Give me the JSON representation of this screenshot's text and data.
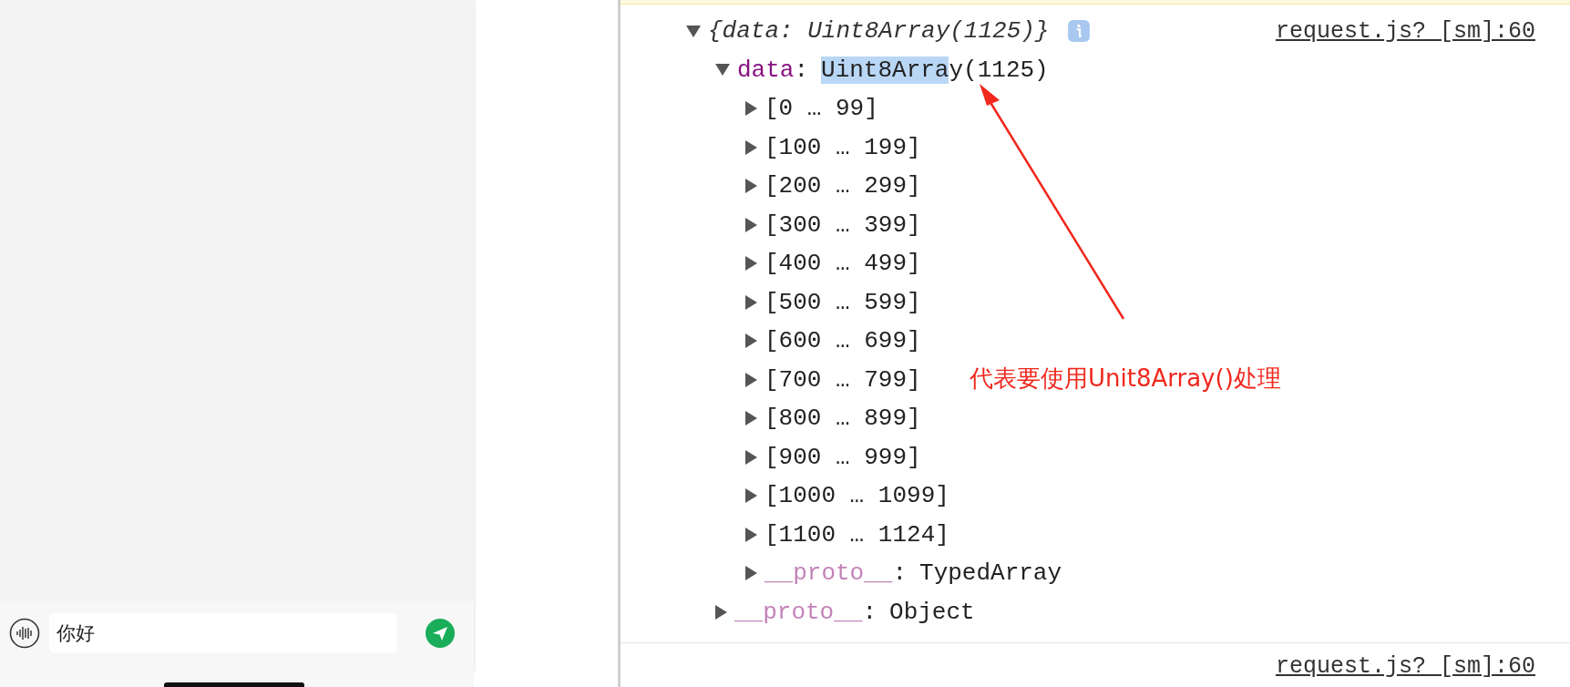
{
  "chat_panel": {
    "input": {
      "value": "你好"
    }
  },
  "console": {
    "entry": {
      "summary": "{data: Uint8Array(1125)}",
      "source": "request.js? [sm]:60",
      "expanded": true,
      "children": [
        {
          "kind": "property",
          "key": "data",
          "separator": ":",
          "dimmed": false,
          "value_parts": [
            {
              "text": "Uint8Arra",
              "selected": true
            },
            {
              "text": "y(1125)",
              "selected": false
            }
          ],
          "expanded": true,
          "children": [
            {
              "kind": "range",
              "label": "[0 … 99]",
              "expanded": false
            },
            {
              "kind": "range",
              "label": "[100 … 199]",
              "expanded": false
            },
            {
              "kind": "range",
              "label": "[200 … 299]",
              "expanded": false
            },
            {
              "kind": "range",
              "label": "[300 … 399]",
              "expanded": false
            },
            {
              "kind": "range",
              "label": "[400 … 499]",
              "expanded": false
            },
            {
              "kind": "range",
              "label": "[500 … 599]",
              "expanded": false
            },
            {
              "kind": "range",
              "label": "[600 … 699]",
              "expanded": false
            },
            {
              "kind": "range",
              "label": "[700 … 799]",
              "expanded": false
            },
            {
              "kind": "range",
              "label": "[800 … 899]",
              "expanded": false
            },
            {
              "kind": "range",
              "label": "[900 … 999]",
              "expanded": false
            },
            {
              "kind": "range",
              "label": "[1000 … 1099]",
              "expanded": false
            },
            {
              "kind": "range",
              "label": "[1100 … 1124]",
              "expanded": false
            },
            {
              "kind": "property",
              "key": "__proto__",
              "separator": ":",
              "dimmed": true,
              "value_parts": [
                {
                  "text": "TypedArray",
                  "selected": false
                }
              ],
              "expanded": false
            }
          ]
        },
        {
          "kind": "property",
          "key": "__proto__",
          "separator": ":",
          "dimmed": true,
          "value_parts": [
            {
              "text": "Object",
              "selected": false
            }
          ],
          "expanded": false
        }
      ]
    },
    "next_source": "request.js? [sm]:60"
  },
  "annotation": {
    "text": "代表要使用Unit8Array()处理"
  }
}
